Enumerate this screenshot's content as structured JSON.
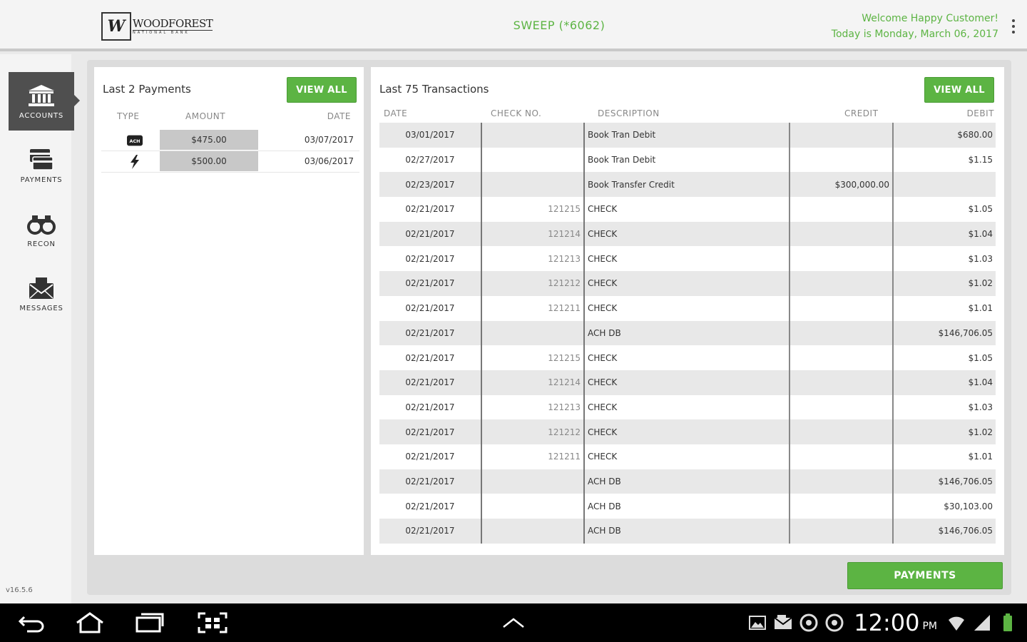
{
  "header": {
    "logo_name": "WOODFOREST",
    "logo_sub": "NATIONAL BANK",
    "logo_mark": "W",
    "account_title": "SWEEP (*6062)",
    "welcome_line": "Welcome Happy Customer!",
    "date_line": "Today is Monday, March 06, 2017"
  },
  "sidebar": {
    "items": [
      {
        "label": "ACCOUNTS",
        "icon": "bank-icon",
        "active": true
      },
      {
        "label": "PAYMENTS",
        "icon": "payments-icon",
        "active": false
      },
      {
        "label": "RECON",
        "icon": "binoculars-icon",
        "active": false
      },
      {
        "label": "MESSAGES",
        "icon": "envelope-icon",
        "active": false
      }
    ],
    "version": "v16.5.6"
  },
  "payments_panel": {
    "title": "Last 2 Payments",
    "view_all": "VIEW ALL",
    "headers": {
      "type": "TYPE",
      "amount": "AMOUNT",
      "date": "DATE"
    },
    "rows": [
      {
        "type_icon": "ach-icon",
        "amount": "$475.00",
        "date": "03/07/2017"
      },
      {
        "type_icon": "flash-icon",
        "amount": "$500.00",
        "date": "03/06/2017"
      }
    ]
  },
  "transactions_panel": {
    "title": "Last 75 Transactions",
    "view_all": "VIEW ALL",
    "headers": {
      "date": "DATE",
      "check_no": "CHECK NO.",
      "description": "DESCRIPTION",
      "credit": "CREDIT",
      "debit": "DEBIT"
    },
    "rows": [
      {
        "date": "03/01/2017",
        "check": "",
        "desc": "Book Tran Debit",
        "credit": "",
        "debit": "$680.00"
      },
      {
        "date": "02/27/2017",
        "check": "",
        "desc": "Book Tran Debit",
        "credit": "",
        "debit": "$1.15"
      },
      {
        "date": "02/23/2017",
        "check": "",
        "desc": "Book Transfer Credit",
        "credit": "$300,000.00",
        "debit": ""
      },
      {
        "date": "02/21/2017",
        "check": "121215",
        "desc": "CHECK",
        "credit": "",
        "debit": "$1.05"
      },
      {
        "date": "02/21/2017",
        "check": "121214",
        "desc": "CHECK",
        "credit": "",
        "debit": "$1.04"
      },
      {
        "date": "02/21/2017",
        "check": "121213",
        "desc": "CHECK",
        "credit": "",
        "debit": "$1.03"
      },
      {
        "date": "02/21/2017",
        "check": "121212",
        "desc": "CHECK",
        "credit": "",
        "debit": "$1.02"
      },
      {
        "date": "02/21/2017",
        "check": "121211",
        "desc": "CHECK",
        "credit": "",
        "debit": "$1.01"
      },
      {
        "date": "02/21/2017",
        "check": "",
        "desc": "ACH DB",
        "credit": "",
        "debit": "$146,706.05"
      },
      {
        "date": "02/21/2017",
        "check": "121215",
        "desc": "CHECK",
        "credit": "",
        "debit": "$1.05"
      },
      {
        "date": "02/21/2017",
        "check": "121214",
        "desc": "CHECK",
        "credit": "",
        "debit": "$1.04"
      },
      {
        "date": "02/21/2017",
        "check": "121213",
        "desc": "CHECK",
        "credit": "",
        "debit": "$1.03"
      },
      {
        "date": "02/21/2017",
        "check": "121212",
        "desc": "CHECK",
        "credit": "",
        "debit": "$1.02"
      },
      {
        "date": "02/21/2017",
        "check": "121211",
        "desc": "CHECK",
        "credit": "",
        "debit": "$1.01"
      },
      {
        "date": "02/21/2017",
        "check": "",
        "desc": "ACH DB",
        "credit": "",
        "debit": "$146,706.05"
      },
      {
        "date": "02/21/2017",
        "check": "",
        "desc": "ACH DB",
        "credit": "",
        "debit": "$30,103.00"
      },
      {
        "date": "02/21/2017",
        "check": "",
        "desc": "ACH DB",
        "credit": "",
        "debit": "$146,706.05"
      }
    ]
  },
  "payments_button": "PAYMENTS",
  "system_bar": {
    "clock": "12:00",
    "ampm": "PM",
    "left_icons": [
      "back-icon",
      "home-icon",
      "recent-apps-icon",
      "screenshot-icon"
    ],
    "center_icon": "chevron-up-icon",
    "right_icons": [
      "gallery-icon",
      "email-notification-icon",
      "notification-icon",
      "notification-icon",
      "wifi-icon",
      "signal-icon",
      "battery-icon"
    ]
  },
  "colors": {
    "accent": "#5cb443",
    "sidebar_active": "#4f4f4f",
    "row_alt": "#e8e8e8"
  }
}
